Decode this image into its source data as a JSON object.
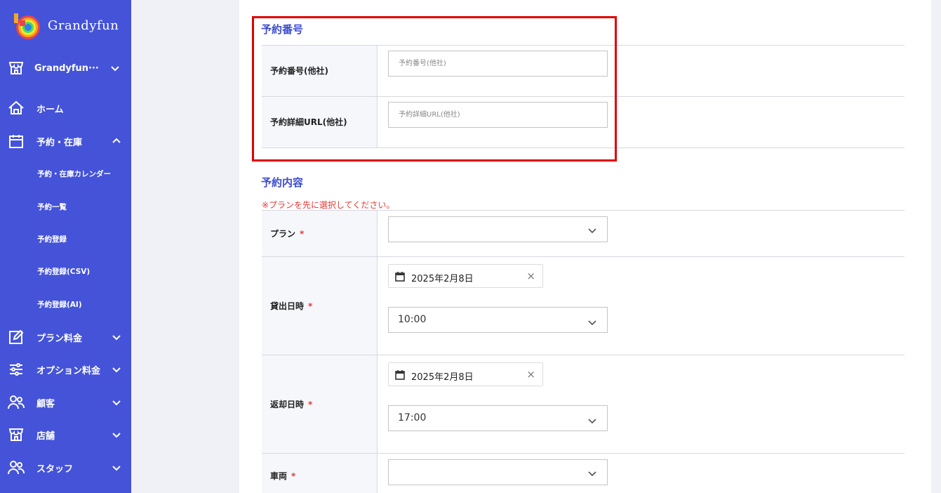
{
  "app": {
    "brand": "Grandyfun"
  },
  "sidebar": {
    "store_selector": "Grandyfun···",
    "items": [
      {
        "label": "ホーム",
        "icon": "home-icon"
      },
      {
        "label": "予約・在庫",
        "icon": "calendar-icon",
        "expanded": true
      },
      {
        "label": "プラン料金",
        "icon": "edit-icon"
      },
      {
        "label": "オプション料金",
        "icon": "sliders-icon"
      },
      {
        "label": "顧客",
        "icon": "people-icon"
      },
      {
        "label": "店舗",
        "icon": "store-icon"
      },
      {
        "label": "スタッフ",
        "icon": "people-icon"
      }
    ],
    "sub_items": [
      {
        "label": "予約・在庫カレンダー"
      },
      {
        "label": "予約一覧"
      },
      {
        "label": "予約登録"
      },
      {
        "label": "予約登録(CSV)"
      },
      {
        "label": "予約登録(AI)"
      }
    ]
  },
  "form": {
    "booking_number_section": {
      "title": "予約番号",
      "fields": [
        {
          "label": "予約番号(他社)",
          "placeholder": "予約番号(他社)"
        },
        {
          "label": "予約詳細URL(他社)",
          "placeholder": "予約詳細URL(他社)"
        }
      ]
    },
    "booking_details_section": {
      "title": "予約内容",
      "note": "※プランを先に選択してください。",
      "plan": {
        "label": "プラン",
        "required_mark": "*",
        "value": ""
      },
      "rental_datetime": {
        "label": "貸出日時",
        "required_mark": "*",
        "date": "2025年2月8日",
        "time": "10:00"
      },
      "return_datetime": {
        "label": "返却日時",
        "required_mark": "*",
        "date": "2025年2月8日",
        "time": "17:00"
      },
      "vehicle": {
        "label": "車両",
        "required_mark": "*",
        "value": ""
      }
    }
  },
  "colors": {
    "sidebar": "#4453d8",
    "accent": "#3c4bd0",
    "required": "#e53935",
    "highlight": "#e00000"
  }
}
